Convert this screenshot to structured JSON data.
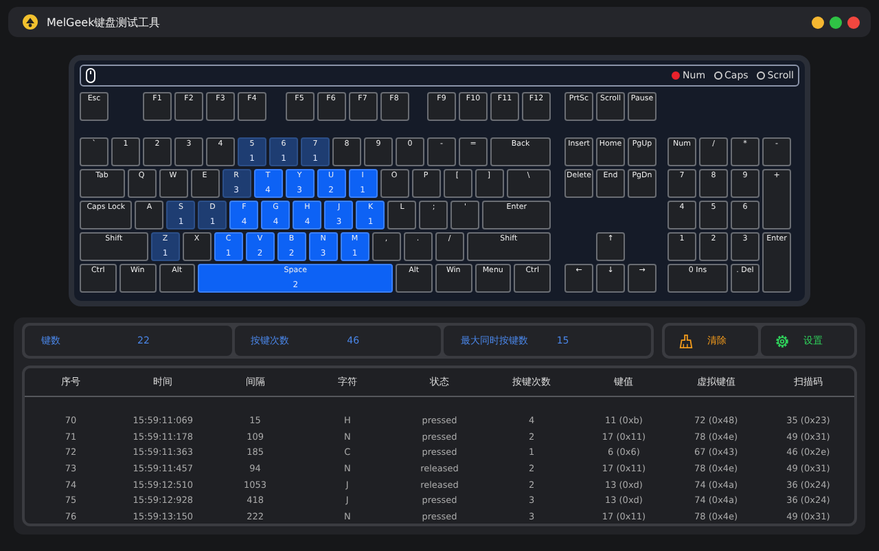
{
  "window": {
    "title": "MelGeek键盘测试工具"
  },
  "keyboard": {
    "indicators": [
      {
        "label": "Num",
        "on": true
      },
      {
        "label": "Caps",
        "on": false
      },
      {
        "label": "Scroll",
        "on": false
      }
    ],
    "main": [
      {
        "label": "Esc"
      },
      {
        "label": "F1"
      },
      {
        "label": "F2"
      },
      {
        "label": "F3"
      },
      {
        "label": "F4"
      },
      {
        "label": "F5"
      },
      {
        "label": "F6"
      },
      {
        "label": "F7"
      },
      {
        "label": "F8"
      },
      {
        "label": "F9"
      },
      {
        "label": "F10"
      },
      {
        "label": "F11"
      },
      {
        "label": "F12"
      },
      {
        "label": "`"
      },
      {
        "label": "1"
      },
      {
        "label": "2"
      },
      {
        "label": "3"
      },
      {
        "label": "4"
      },
      {
        "label": "5",
        "count": "1",
        "active": false
      },
      {
        "label": "6",
        "count": "1",
        "active": false
      },
      {
        "label": "7",
        "count": "1",
        "active": false
      },
      {
        "label": "8"
      },
      {
        "label": "9"
      },
      {
        "label": "0"
      },
      {
        "label": "-"
      },
      {
        "label": "="
      },
      {
        "label": "Back"
      },
      {
        "label": "Tab"
      },
      {
        "label": "Q"
      },
      {
        "label": "W"
      },
      {
        "label": "E"
      },
      {
        "label": "R",
        "count": "3",
        "active": false
      },
      {
        "label": "T",
        "count": "4",
        "active": true
      },
      {
        "label": "Y",
        "count": "3",
        "active": true
      },
      {
        "label": "U",
        "count": "2",
        "active": true
      },
      {
        "label": "I",
        "count": "1",
        "active": true
      },
      {
        "label": "O"
      },
      {
        "label": "P"
      },
      {
        "label": "["
      },
      {
        "label": "]"
      },
      {
        "label": "\\"
      },
      {
        "label": "Caps Lock"
      },
      {
        "label": "A"
      },
      {
        "label": "S",
        "count": "1",
        "active": false
      },
      {
        "label": "D",
        "count": "1",
        "active": false
      },
      {
        "label": "F",
        "count": "4",
        "active": true
      },
      {
        "label": "G",
        "count": "4",
        "active": true
      },
      {
        "label": "H",
        "count": "4",
        "active": true
      },
      {
        "label": "J",
        "count": "3",
        "active": true
      },
      {
        "label": "K",
        "count": "1",
        "active": true
      },
      {
        "label": "L"
      },
      {
        "label": ";"
      },
      {
        "label": "'"
      },
      {
        "label": "Enter"
      },
      {
        "label": "Shift"
      },
      {
        "label": "Z",
        "count": "1",
        "active": false
      },
      {
        "label": "X"
      },
      {
        "label": "C",
        "count": "1",
        "active": true
      },
      {
        "label": "V",
        "count": "2",
        "active": true
      },
      {
        "label": "B",
        "count": "2",
        "active": true
      },
      {
        "label": "N",
        "count": "3",
        "active": true
      },
      {
        "label": "M",
        "count": "1",
        "active": true
      },
      {
        "label": ","
      },
      {
        "label": "."
      },
      {
        "label": "/"
      },
      {
        "label": "Shift"
      },
      {
        "label": "Ctrl"
      },
      {
        "label": "Win"
      },
      {
        "label": "Alt"
      },
      {
        "label": "Space",
        "count": "2",
        "active": true
      },
      {
        "label": "Alt"
      },
      {
        "label": "Win"
      },
      {
        "label": "Menu"
      },
      {
        "label": "Ctrl"
      }
    ],
    "nav": [
      {
        "label": "PrtSc"
      },
      {
        "label": "Scroll"
      },
      {
        "label": "Pause"
      },
      {
        "label": "Insert"
      },
      {
        "label": "Home"
      },
      {
        "label": "PgUp"
      },
      {
        "label": "Delete"
      },
      {
        "label": "End"
      },
      {
        "label": "PgDn"
      },
      {
        "label": "↑"
      },
      {
        "label": "←"
      },
      {
        "label": "↓"
      },
      {
        "label": "→"
      }
    ],
    "numpad": [
      {
        "label": "Num"
      },
      {
        "label": "/"
      },
      {
        "label": "*"
      },
      {
        "label": "-"
      },
      {
        "label": "7"
      },
      {
        "label": "8"
      },
      {
        "label": "9"
      },
      {
        "label": "+"
      },
      {
        "label": "4"
      },
      {
        "label": "5"
      },
      {
        "label": "6"
      },
      {
        "label": "1"
      },
      {
        "label": "2"
      },
      {
        "label": "3"
      },
      {
        "label": "Enter"
      },
      {
        "label": "0 Ins"
      },
      {
        "label": ". Del"
      }
    ]
  },
  "stats": [
    {
      "label": "键数",
      "value": "22"
    },
    {
      "label": "按键次数",
      "value": "46"
    },
    {
      "label": "最大同时按键数",
      "value": "15"
    }
  ],
  "actions": [
    {
      "kind": "clear",
      "label": "清除"
    },
    {
      "kind": "settings",
      "label": "设置"
    }
  ],
  "table": {
    "columns": [
      "序号",
      "时间",
      "间隔",
      "字符",
      "状态",
      "按键次数",
      "键值",
      "虚拟键值",
      "扫描码"
    ],
    "rows": [
      [
        "70",
        "15:59:11:069",
        "15",
        "H",
        "pressed",
        "4",
        "11 (0xb)",
        "72 (0x48)",
        "35 (0x23)"
      ],
      [
        "71",
        "15:59:11:178",
        "109",
        "N",
        "pressed",
        "2",
        "17 (0x11)",
        "78 (0x4e)",
        "49 (0x31)"
      ],
      [
        "72",
        "15:59:11:363",
        "185",
        "C",
        "pressed",
        "1",
        "6 (0x6)",
        "67 (0x43)",
        "46 (0x2e)"
      ],
      [
        "73",
        "15:59:11:457",
        "94",
        "N",
        "released",
        "2",
        "17 (0x11)",
        "78 (0x4e)",
        "49 (0x31)"
      ],
      [
        "74",
        "15:59:12:510",
        "1053",
        "J",
        "released",
        "2",
        "13 (0xd)",
        "74 (0x4a)",
        "36 (0x24)"
      ],
      [
        "75",
        "15:59:12:928",
        "418",
        "J",
        "pressed",
        "3",
        "13 (0xd)",
        "74 (0x4a)",
        "36 (0x24)"
      ],
      [
        "76",
        "15:59:13:150",
        "222",
        "N",
        "pressed",
        "3",
        "17 (0x11)",
        "78 (0x4e)",
        "49 (0x31)"
      ]
    ]
  }
}
